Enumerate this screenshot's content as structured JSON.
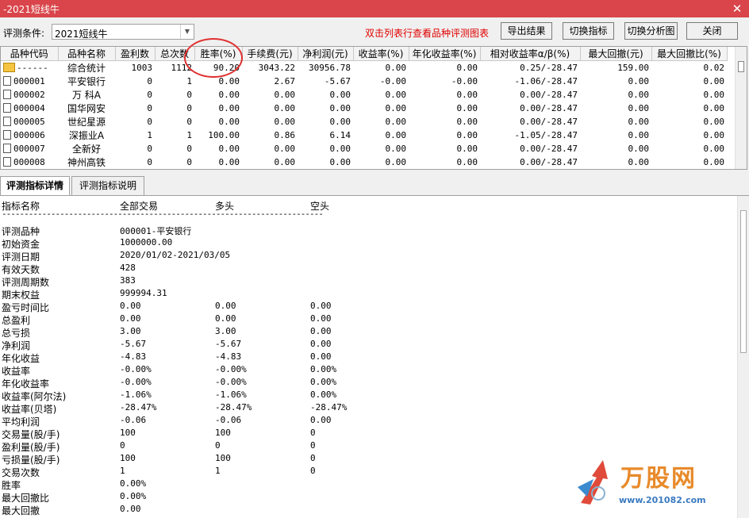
{
  "window": {
    "title": "-2021短线牛"
  },
  "toolbar": {
    "label": "评测条件:",
    "condition": "2021短线牛",
    "hint": "双击列表行查看品种评测图表",
    "buttons": [
      "导出结果",
      "切换指标",
      "切换分析图",
      "关闭"
    ]
  },
  "grid": {
    "columns": [
      "品种代码",
      "品种名称",
      "盈利数",
      "总次数",
      "胜率(%)",
      "手续费(元)",
      "净利润(元)",
      "收益率(%)",
      "年化收益率(%)",
      "相对收益率α/β(%)",
      "最大回撤(元)",
      "最大回撤比(%)"
    ],
    "rows": [
      {
        "code": "------",
        "name": "综合统计",
        "icon": "folder",
        "cells": [
          "1003",
          "1112",
          "90.20",
          "3043.22",
          "30956.78",
          "0.00",
          "0.00",
          "0.25/-28.47",
          "159.00",
          "0.02"
        ]
      },
      {
        "code": "000001",
        "name": "平安银行",
        "icon": "doc",
        "cells": [
          "0",
          "1",
          "0.00",
          "2.67",
          "-5.67",
          "-0.00",
          "-0.00",
          "-1.06/-28.47",
          "0.00",
          "0.00"
        ]
      },
      {
        "code": "000002",
        "name": "万 科A",
        "icon": "doc",
        "cells": [
          "0",
          "0",
          "0.00",
          "0.00",
          "0.00",
          "0.00",
          "0.00",
          "0.00/-28.47",
          "0.00",
          "0.00"
        ]
      },
      {
        "code": "000004",
        "name": "国华网安",
        "icon": "doc",
        "cells": [
          "0",
          "0",
          "0.00",
          "0.00",
          "0.00",
          "0.00",
          "0.00",
          "0.00/-28.47",
          "0.00",
          "0.00"
        ]
      },
      {
        "code": "000005",
        "name": "世纪星源",
        "icon": "doc",
        "cells": [
          "0",
          "0",
          "0.00",
          "0.00",
          "0.00",
          "0.00",
          "0.00",
          "0.00/-28.47",
          "0.00",
          "0.00"
        ]
      },
      {
        "code": "000006",
        "name": "深振业A",
        "icon": "doc",
        "cells": [
          "1",
          "1",
          "100.00",
          "0.86",
          "6.14",
          "0.00",
          "0.00",
          "-1.05/-28.47",
          "0.00",
          "0.00"
        ]
      },
      {
        "code": "000007",
        "name": "全新好",
        "icon": "doc",
        "cells": [
          "0",
          "0",
          "0.00",
          "0.00",
          "0.00",
          "0.00",
          "0.00",
          "0.00/-28.47",
          "0.00",
          "0.00"
        ]
      },
      {
        "code": "000008",
        "name": "神州高铁",
        "icon": "doc",
        "cells": [
          "0",
          "0",
          "0.00",
          "0.00",
          "0.00",
          "0.00",
          "0.00",
          "0.00/-28.47",
          "0.00",
          "0.00"
        ]
      }
    ]
  },
  "tabs": [
    "评测指标详情",
    "评测指标说明"
  ],
  "detail": {
    "headers": [
      "指标名称",
      "全部交易",
      "多头",
      "空头"
    ],
    "separator": "------------------------------------------------------------------------",
    "rows": [
      [
        "评测品种",
        "000001-平安银行",
        "",
        ""
      ],
      [
        "初始资金",
        "1000000.00",
        "",
        ""
      ],
      [
        "评测日期",
        "2020/01/02-2021/03/05",
        "",
        ""
      ],
      [
        "有效天数",
        "428",
        "",
        ""
      ],
      [
        "评测周期数",
        "383",
        "",
        ""
      ],
      [
        "期末权益",
        "999994.31",
        "",
        ""
      ],
      [
        "盈亏时间比",
        "0.00",
        "0.00",
        "0.00"
      ],
      [
        "总盈利",
        "0.00",
        "0.00",
        "0.00"
      ],
      [
        "总亏损",
        "3.00",
        "3.00",
        "0.00"
      ],
      [
        "净利润",
        "-5.67",
        "-5.67",
        "0.00"
      ],
      [
        "年化收益",
        "-4.83",
        "-4.83",
        "0.00"
      ],
      [
        "收益率",
        "-0.00%",
        "-0.00%",
        "0.00%"
      ],
      [
        "年化收益率",
        "-0.00%",
        "-0.00%",
        "0.00%"
      ],
      [
        "收益率(阿尔法)",
        "-1.06%",
        "-1.06%",
        "0.00%"
      ],
      [
        "收益率(贝塔)",
        "-28.47%",
        "-28.47%",
        "-28.47%"
      ],
      [
        "平均利润",
        "-0.06",
        "-0.06",
        "0.00"
      ],
      [
        "交易量(股/手)",
        "100",
        "100",
        "0"
      ],
      [
        "盈利量(股/手)",
        "0",
        "0",
        "0"
      ],
      [
        "亏损量(股/手)",
        "100",
        "100",
        "0"
      ],
      [
        "交易次数",
        "1",
        "1",
        "0"
      ],
      [
        "胜率",
        "0.00%",
        "",
        ""
      ],
      [
        "最大回撤比",
        "0.00%",
        "",
        ""
      ],
      [
        "最大回撤",
        "0.00",
        "",
        ""
      ]
    ]
  },
  "watermark": {
    "logo": "万股网",
    "url": "www.201082.com"
  },
  "colors": {
    "titlebar": "#d9454a",
    "hint": "#e00000",
    "highlight_circle": "#e03030"
  }
}
